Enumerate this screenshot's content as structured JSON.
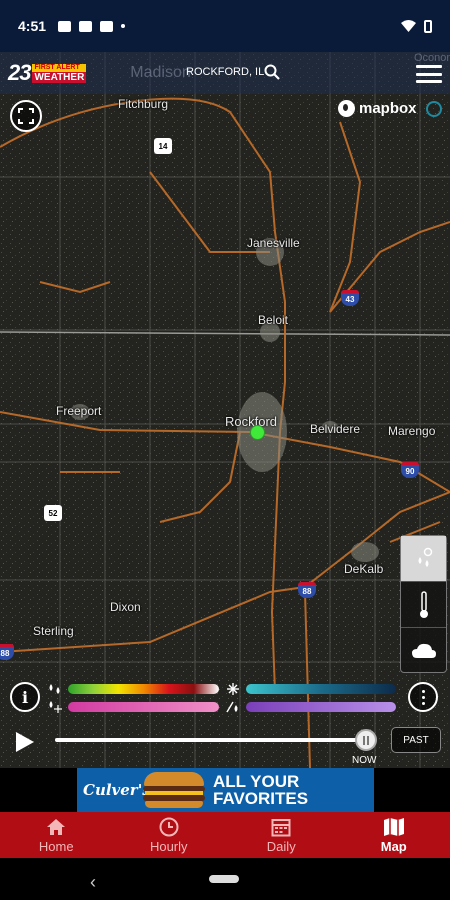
{
  "status_bar": {
    "time": "4:51"
  },
  "header": {
    "logo_number": "23",
    "logo_tag": "FIRST ALERT",
    "logo_word": "WEATHER",
    "map_label_behind": "Madison",
    "location": "ROCKFORD, IL",
    "map_label_right": "Oconomowoc"
  },
  "map": {
    "attribution": "mapbox",
    "cities": [
      {
        "name": "Fitchburg"
      },
      {
        "name": "Janesville"
      },
      {
        "name": "Beloit"
      },
      {
        "name": "Freeport"
      },
      {
        "name": "Rockford"
      },
      {
        "name": "Belvidere"
      },
      {
        "name": "Marengo"
      },
      {
        "name": "DeKalb"
      },
      {
        "name": "Dixon"
      },
      {
        "name": "Sterling"
      }
    ],
    "shields": [
      "14",
      "43",
      "90",
      "52",
      "88",
      "88"
    ]
  },
  "layers": [
    "precipitation",
    "temperature",
    "clouds"
  ],
  "legend": {
    "rain_colors": [
      "#2fa32a",
      "#8fd13b",
      "#f2e400",
      "#f08a00",
      "#d8141b",
      "#8a1010",
      "#ffffff"
    ],
    "snow_colors": [
      "#3cc4cc",
      "#1b6b8a",
      "#0d2b4a"
    ],
    "mix_colors": [
      "#d13aa0",
      "#f090c8"
    ],
    "ice_colors": [
      "#7a3fb8",
      "#b890e8"
    ]
  },
  "timeline": {
    "now_label": "NOW",
    "past_label": "PAST"
  },
  "ad": {
    "brand": "Culver's",
    "line1": "ALL YOUR",
    "line2": "FAVORITES"
  },
  "nav": [
    {
      "label": "Home",
      "icon": "home-icon"
    },
    {
      "label": "Hourly",
      "icon": "clock-icon"
    },
    {
      "label": "Daily",
      "icon": "calendar-icon"
    },
    {
      "label": "Map",
      "icon": "map-icon"
    }
  ],
  "active_nav": "Map"
}
